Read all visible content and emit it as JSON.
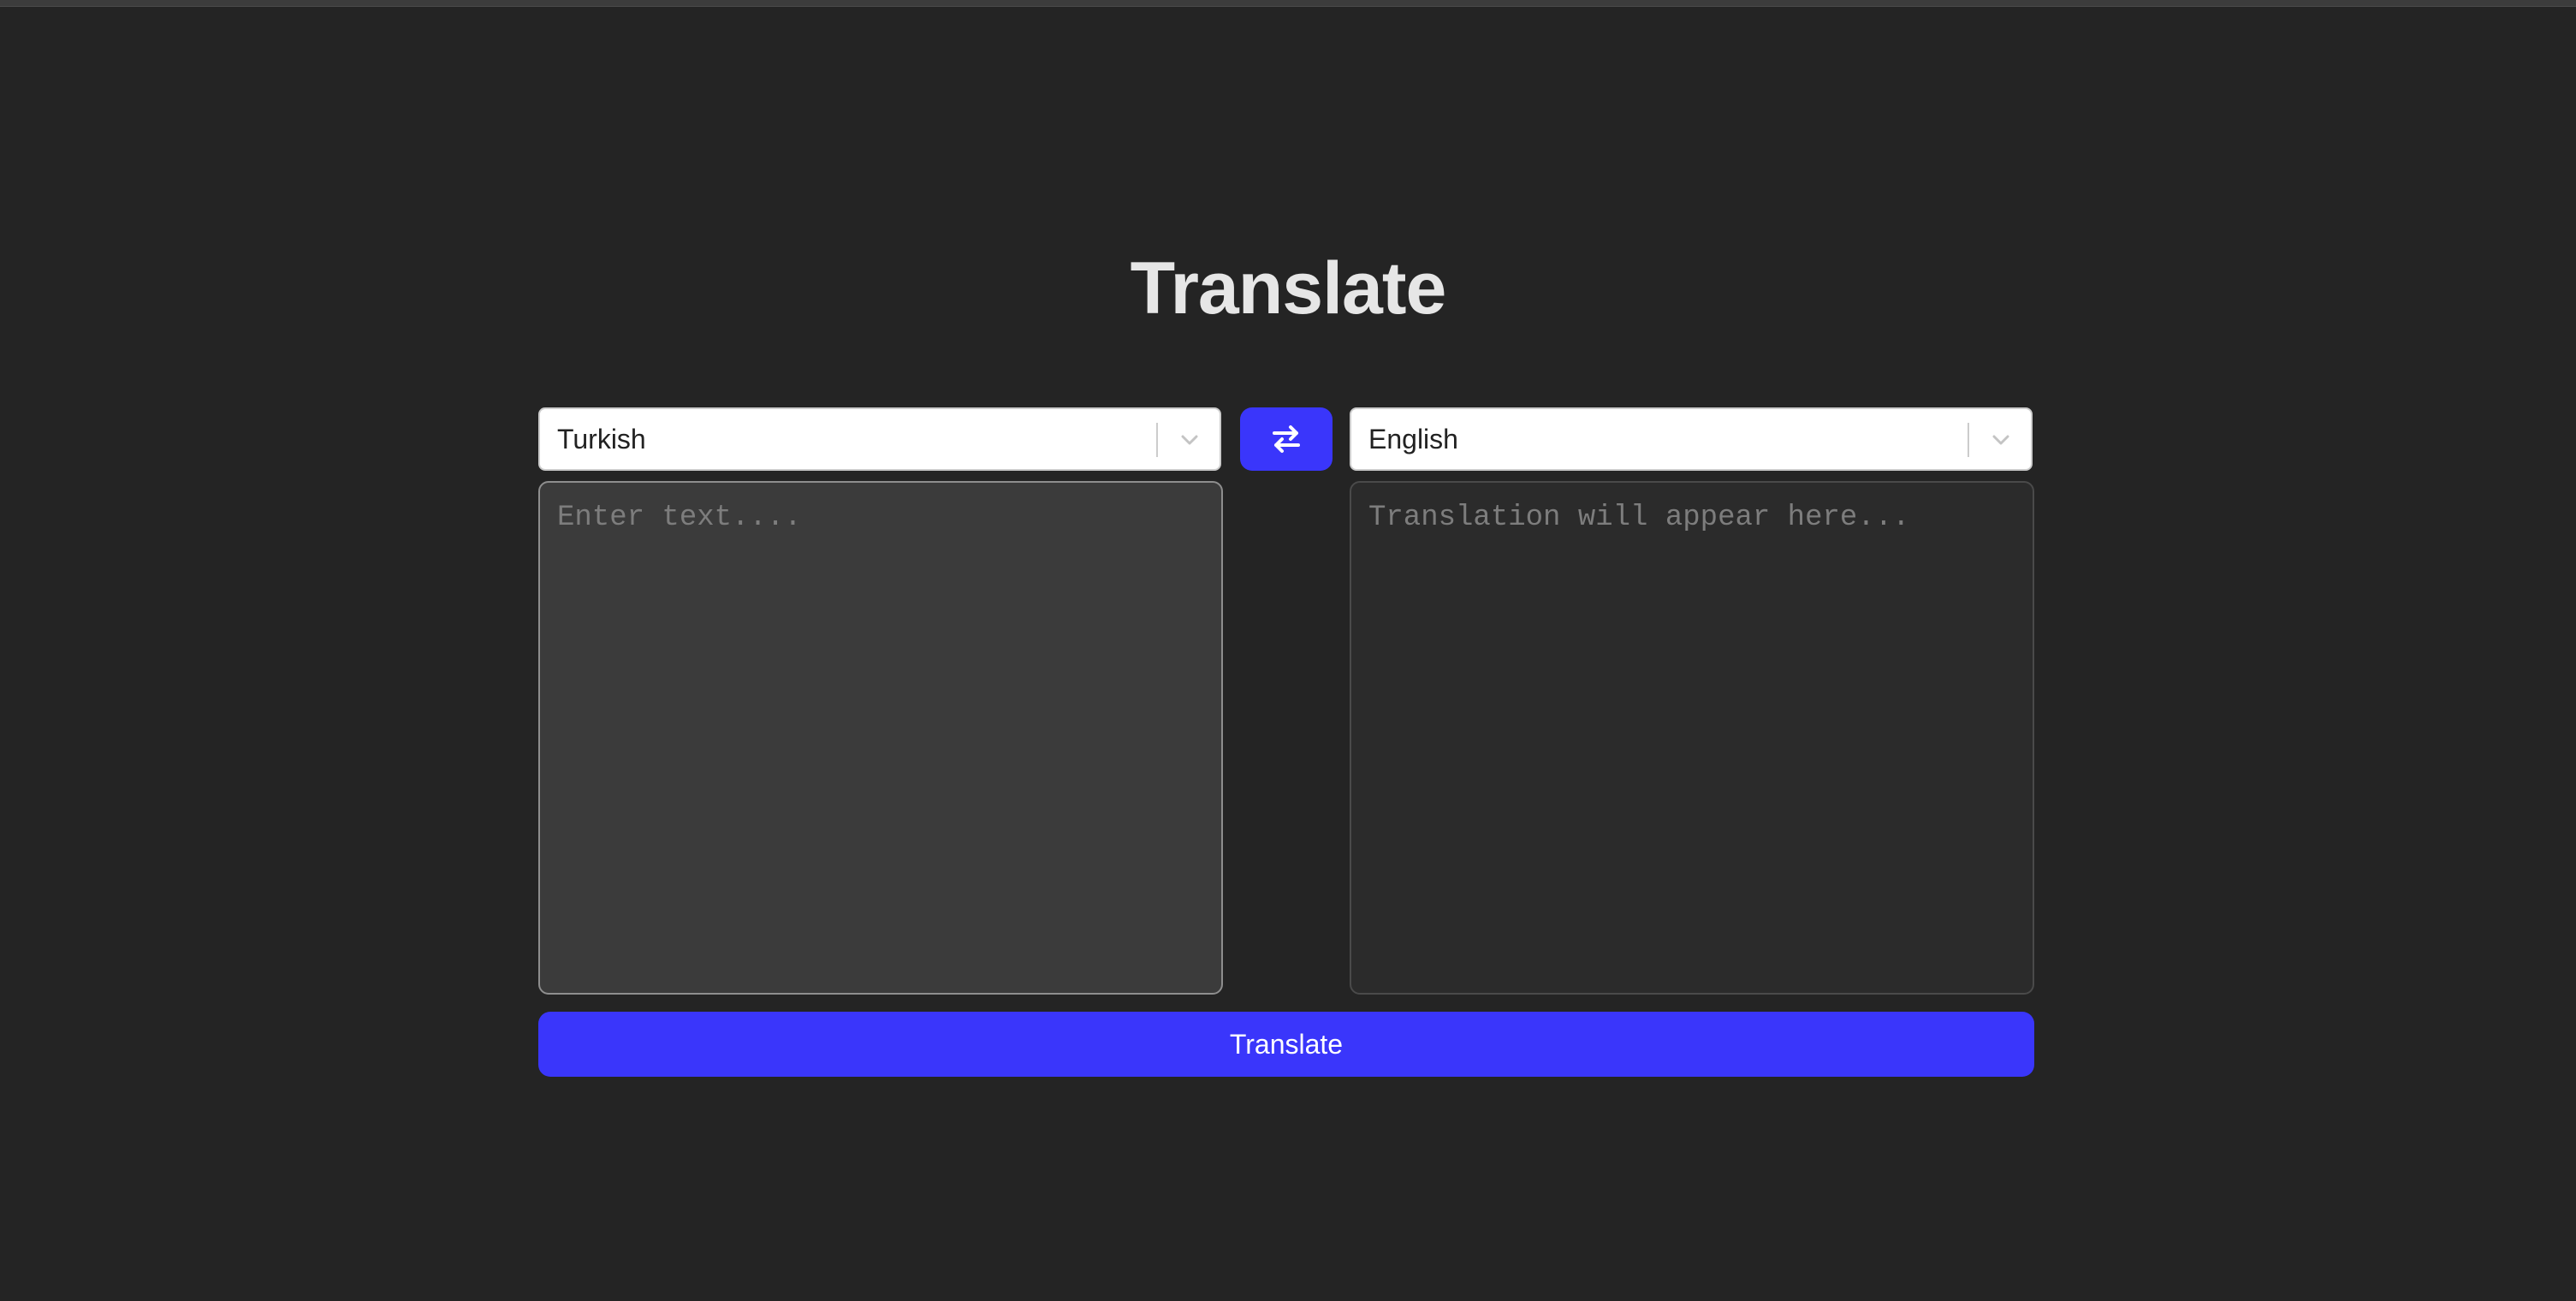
{
  "header": {
    "title": "Translate"
  },
  "source": {
    "language": "Turkish",
    "placeholder": "Enter text....",
    "value": ""
  },
  "target": {
    "language": "English",
    "placeholder": "Translation will appear here...",
    "value": ""
  },
  "actions": {
    "swap_icon": "swap-arrows-icon",
    "translate_label": "Translate"
  },
  "colors": {
    "background": "#242424",
    "accent": "#3a36fb",
    "title": "#e6e6e6"
  }
}
